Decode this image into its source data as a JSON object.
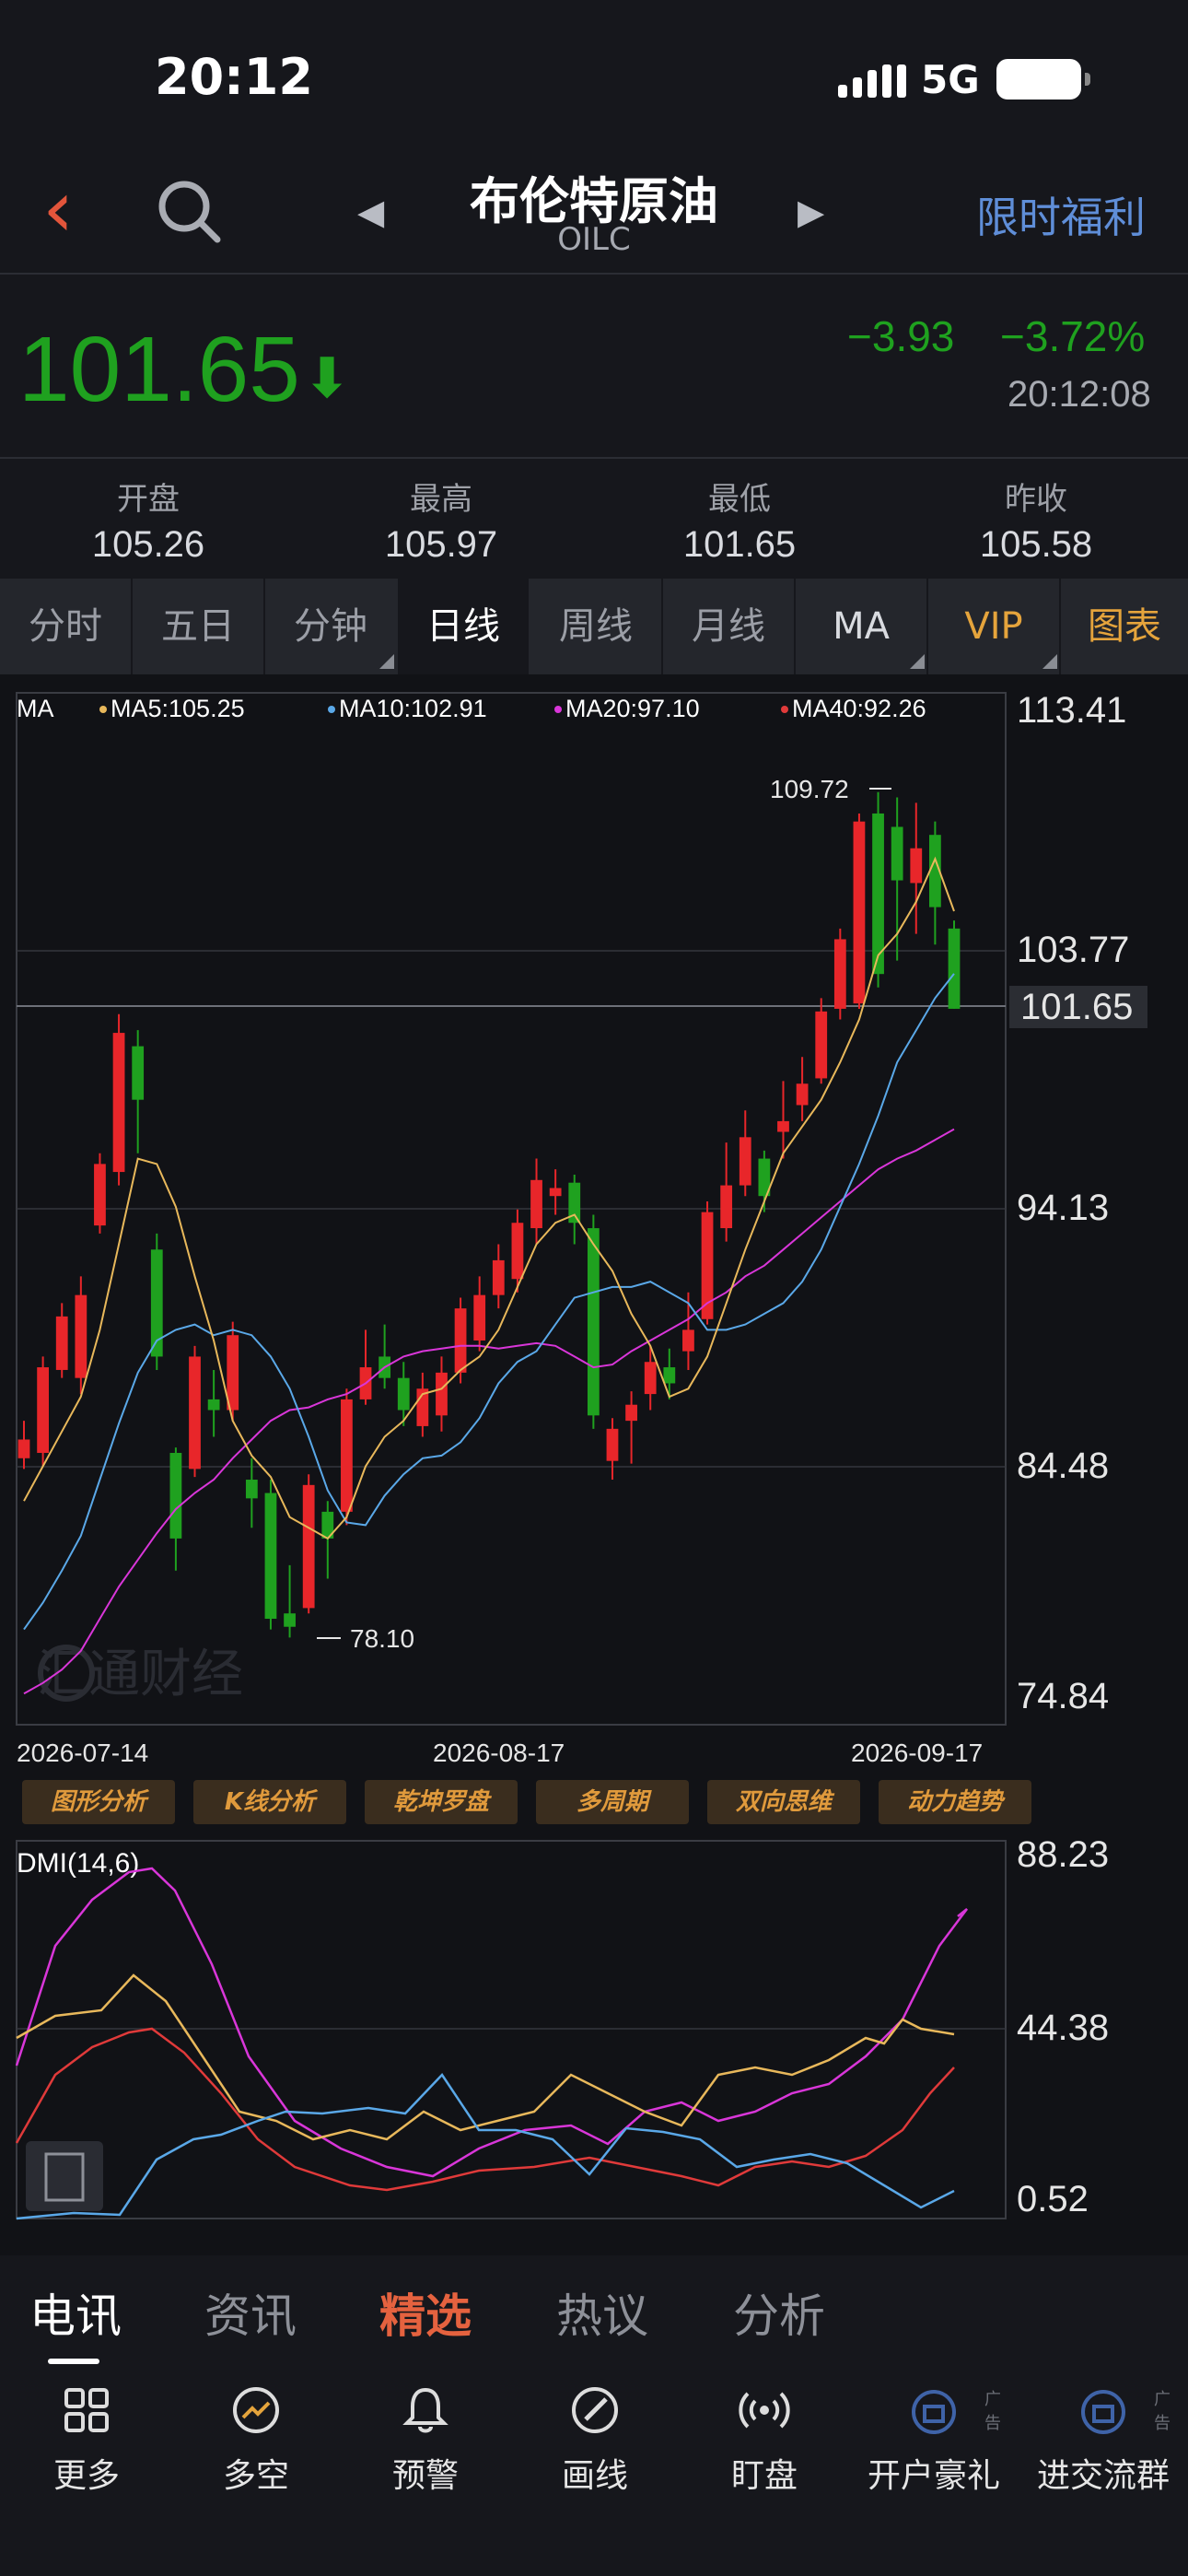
{
  "status_bar": {
    "time": "20:12",
    "network": "5G"
  },
  "nav": {
    "title": "布伦特原油",
    "code": "OILC",
    "promo": "限时福利"
  },
  "quote": {
    "price": "101.65",
    "change": "−3.93",
    "change_pct": "−3.72%",
    "time": "20:12:08",
    "down_color": "#1fa11f"
  },
  "ohlc": [
    {
      "label": "开盘",
      "value": "105.26"
    },
    {
      "label": "最高",
      "value": "105.97"
    },
    {
      "label": "最低",
      "value": "101.65"
    },
    {
      "label": "昨收",
      "value": "105.58"
    }
  ],
  "tabs": [
    {
      "label": "分时",
      "active": false
    },
    {
      "label": "五日",
      "active": false
    },
    {
      "label": "分钟",
      "active": false,
      "dropdown": true
    },
    {
      "label": "日线",
      "active": true
    },
    {
      "label": "周线",
      "active": false
    },
    {
      "label": "月线",
      "active": false
    },
    {
      "label": "MA",
      "active": false,
      "dropdown": true
    },
    {
      "label": "VIP",
      "active": false,
      "dropdown": true
    },
    {
      "label": "图表",
      "active": false
    }
  ],
  "main_chart": {
    "legend": {
      "ma_label": "MA",
      "ma5": "MA5:105.25",
      "ma10": "MA10:102.91",
      "ma20": "MA20:97.10",
      "ma40": "MA40:92.26"
    },
    "y_ticks": [
      "113.41",
      "103.77",
      "94.13",
      "84.48",
      "74.84"
    ],
    "current_price_tag": "101.65",
    "high_marker": "109.72",
    "low_marker": "78.10",
    "x_ticks": [
      "2026-07-14",
      "2026-08-17",
      "2026-09-17"
    ],
    "watermark": "汇通财经",
    "colors": {
      "up": "#e8262a",
      "down": "#1fa11f",
      "ma5": "#e8b85b",
      "ma10": "#5aa8e8",
      "ma20": "#d936d9",
      "ma40": "#e03a3a"
    }
  },
  "chart_data": {
    "type": "candlestick",
    "ylim": [
      74.84,
      113.41
    ],
    "y_ticks": [
      113.41,
      103.77,
      94.13,
      84.48,
      74.84
    ],
    "x_ticks": [
      "2026-07-14",
      "2026-08-17",
      "2026-09-17"
    ],
    "candles": [
      [
        84.8,
        85.5,
        84.4,
        86.2
      ],
      [
        85.0,
        88.2,
        84.5,
        88.6
      ],
      [
        88.1,
        90.1,
        87.8,
        90.6
      ],
      [
        87.8,
        90.9,
        87.2,
        91.6
      ],
      [
        93.5,
        95.8,
        93.2,
        96.2
      ],
      [
        95.5,
        100.7,
        95.0,
        101.4
      ],
      [
        100.2,
        98.2,
        96.2,
        100.8
      ],
      [
        92.6,
        88.6,
        88.1,
        93.2
      ],
      [
        85.0,
        81.8,
        80.6,
        85.2
      ],
      [
        84.4,
        88.6,
        84.1,
        89.0
      ],
      [
        87.0,
        86.6,
        85.6,
        88.1
      ],
      [
        86.6,
        89.4,
        86.2,
        89.9
      ],
      [
        84.0,
        83.3,
        82.2,
        84.8
      ],
      [
        83.5,
        78.8,
        78.4,
        84.0
      ],
      [
        79.0,
        78.5,
        78.1,
        80.8
      ],
      [
        79.2,
        83.8,
        79.0,
        84.2
      ],
      [
        82.8,
        81.8,
        80.3,
        83.2
      ],
      [
        82.8,
        87.0,
        82.3,
        87.4
      ],
      [
        87.0,
        88.2,
        86.8,
        89.6
      ],
      [
        88.6,
        87.8,
        87.4,
        89.8
      ],
      [
        87.8,
        86.6,
        86.0,
        88.4
      ],
      [
        86.0,
        87.4,
        85.6,
        88.0
      ],
      [
        86.4,
        88.0,
        85.8,
        88.6
      ],
      [
        88.0,
        90.4,
        87.6,
        90.8
      ],
      [
        89.2,
        90.9,
        88.8,
        91.6
      ],
      [
        90.9,
        92.2,
        90.4,
        92.8
      ],
      [
        91.5,
        93.6,
        91.0,
        94.1
      ],
      [
        93.4,
        95.2,
        92.8,
        96.0
      ],
      [
        94.6,
        94.9,
        93.9,
        95.6
      ],
      [
        95.1,
        93.6,
        92.8,
        95.4
      ],
      [
        93.4,
        86.4,
        85.9,
        93.9
      ],
      [
        84.7,
        85.9,
        84.0,
        86.3
      ],
      [
        86.2,
        86.8,
        84.6,
        87.3
      ],
      [
        87.2,
        88.4,
        86.6,
        89.0
      ],
      [
        88.2,
        87.6,
        87.0,
        88.9
      ],
      [
        88.8,
        89.6,
        88.1,
        91.0
      ],
      [
        90.0,
        94.0,
        89.8,
        94.4
      ],
      [
        93.4,
        95.0,
        92.9,
        96.6
      ],
      [
        95.0,
        96.8,
        94.6,
        97.8
      ],
      [
        96.0,
        94.6,
        94.0,
        96.3
      ],
      [
        97.0,
        97.4,
        96.0,
        98.9
      ],
      [
        98.0,
        98.8,
        97.4,
        99.8
      ],
      [
        99.0,
        101.5,
        98.8,
        102.0
      ],
      [
        101.6,
        104.2,
        101.2,
        104.6
      ],
      [
        101.8,
        108.6,
        101.6,
        108.9
      ],
      [
        108.9,
        102.9,
        102.4,
        109.7
      ],
      [
        108.4,
        106.4,
        103.4,
        109.5
      ],
      [
        106.3,
        107.6,
        104.4,
        109.3
      ],
      [
        108.1,
        105.4,
        104.0,
        108.6
      ],
      [
        104.6,
        101.6,
        101.6,
        104.9
      ]
    ],
    "ma5": [
      83.2,
      84.5,
      85.8,
      87.1,
      89.6,
      92.8,
      96.0,
      95.8,
      94.2,
      91.6,
      89.2,
      86.2,
      84.9,
      84.1,
      82.6,
      82.2,
      81.8,
      82.6,
      84.5,
      85.6,
      86.2,
      87.2,
      87.4,
      88.1,
      88.6,
      89.6,
      91.2,
      92.8,
      93.6,
      93.9,
      92.8,
      91.8,
      90.2,
      89.0,
      87.1,
      87.4,
      88.6,
      90.6,
      92.6,
      94.4,
      96.2,
      97.2,
      98.2,
      99.6,
      101.2,
      103.6,
      104.4,
      105.6,
      107.2,
      105.25
    ],
    "ma10": [
      78.4,
      79.4,
      80.6,
      81.9,
      84.0,
      86.1,
      88.0,
      89.2,
      89.6,
      89.8,
      89.4,
      89.6,
      89.4,
      88.6,
      87.4,
      85.6,
      83.6,
      82.4,
      82.3,
      83.4,
      84.2,
      84.8,
      84.9,
      85.4,
      86.3,
      87.6,
      88.4,
      88.8,
      89.8,
      90.8,
      91.0,
      91.2,
      91.2,
      91.4,
      91.0,
      90.6,
      89.6,
      89.6,
      89.8,
      90.2,
      90.6,
      91.4,
      92.6,
      94.2,
      95.8,
      97.6,
      99.6,
      100.8,
      102.0,
      102.91
    ],
    "ma20": [
      76.0,
      76.4,
      76.9,
      77.6,
      78.8,
      80.0,
      81.0,
      82.0,
      82.9,
      83.5,
      84.0,
      84.8,
      85.5,
      86.2,
      86.6,
      86.7,
      87.0,
      87.2,
      87.6,
      88.2,
      88.6,
      88.8,
      88.9,
      89.0,
      89.0,
      88.9,
      89.0,
      89.1,
      89.0,
      88.6,
      88.2,
      88.3,
      88.8,
      89.2,
      89.6,
      90.0,
      90.6,
      91.0,
      91.6,
      92.0,
      92.6,
      93.2,
      93.8,
      94.4,
      95.0,
      95.6,
      96.0,
      96.3,
      96.7,
      97.1
    ]
  },
  "tools": [
    "图形分析",
    "K线分析",
    "乾坤罗盘",
    "多周期",
    "双向思维",
    "动力趋势"
  ],
  "dmi_chart": {
    "label": "DMI(14,6)",
    "y_ticks": [
      "88.23",
      "44.38",
      "0.52"
    ]
  },
  "bottom_tabs": [
    {
      "label": "电讯",
      "state": "active"
    },
    {
      "label": "资讯",
      "state": "normal"
    },
    {
      "label": "精选",
      "state": "hot"
    },
    {
      "label": "热议",
      "state": "normal"
    },
    {
      "label": "分析",
      "state": "normal"
    }
  ],
  "toolbar": [
    {
      "label": "更多",
      "icon": "grid-icon"
    },
    {
      "label": "多空",
      "icon": "trend-icon"
    },
    {
      "label": "预警",
      "icon": "bell-icon"
    },
    {
      "label": "画线",
      "icon": "pencil-icon"
    },
    {
      "label": "盯盘",
      "icon": "radar-icon"
    },
    {
      "label": "开户豪礼",
      "icon": "gift-icon",
      "ad": "广告"
    },
    {
      "label": "进交流群",
      "icon": "group-icon",
      "ad": "广告"
    }
  ]
}
